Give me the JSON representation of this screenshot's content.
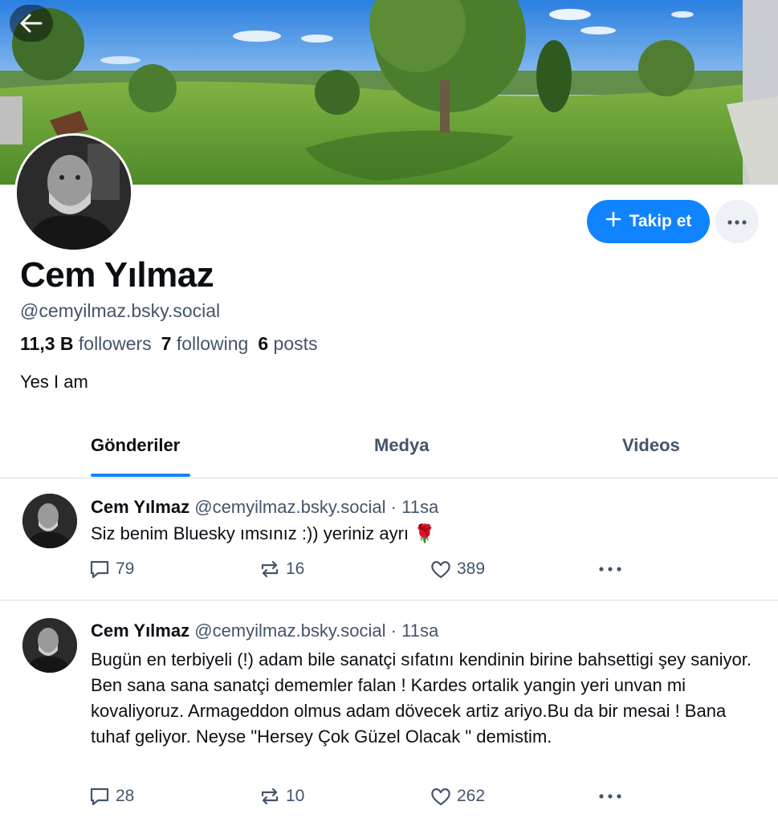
{
  "profile": {
    "display_name": "Cem Yılmaz",
    "handle": "@cemyilmaz.bsky.social",
    "followers_count": "11,3 B",
    "followers_label": "followers",
    "following_count": "7",
    "following_label": "following",
    "posts_count": "6",
    "posts_label": "posts",
    "bio": "Yes I am"
  },
  "actions": {
    "follow_label": "Takip et"
  },
  "tabs": [
    {
      "label": "Gönderiler",
      "active": true
    },
    {
      "label": "Medya",
      "active": false
    },
    {
      "label": "Videos",
      "active": false
    }
  ],
  "posts": [
    {
      "author": "Cem Yılmaz",
      "handle": "@cemyilmaz.bsky.social",
      "time": "· 11sa",
      "text": "Siz benim Bluesky ımsınız :)) yeriniz ayrı 🌹",
      "replies": "79",
      "reposts": "16",
      "likes": "389"
    },
    {
      "author": "Cem Yılmaz",
      "handle": "@cemyilmaz.bsky.social",
      "time": "· 11sa",
      "text": "Bugün en terbiyeli (!) adam bile sanatçi sıfatını kendinin birine bahsettigi şey saniyor. Ben sana sana sanatçi dememler falan ! Kardes ortalik yangin yeri unvan mi kovaliyoruz. Armageddon olmus adam dövecek artiz ariyo.Bu da bir mesai ! Bana tuhaf geliyor. Neyse \"Hersey Çok Güzel Olacak \" demistim.",
      "replies": "28",
      "reposts": "10",
      "likes": "262"
    }
  ],
  "colors": {
    "accent": "#1083fe",
    "text_primary": "#0b0f14",
    "text_secondary": "#44546a",
    "divider": "#d9dee5"
  },
  "icons": [
    "back-arrow-icon",
    "plus-icon",
    "ellipsis-icon",
    "reply-icon",
    "repost-icon",
    "like-icon"
  ]
}
